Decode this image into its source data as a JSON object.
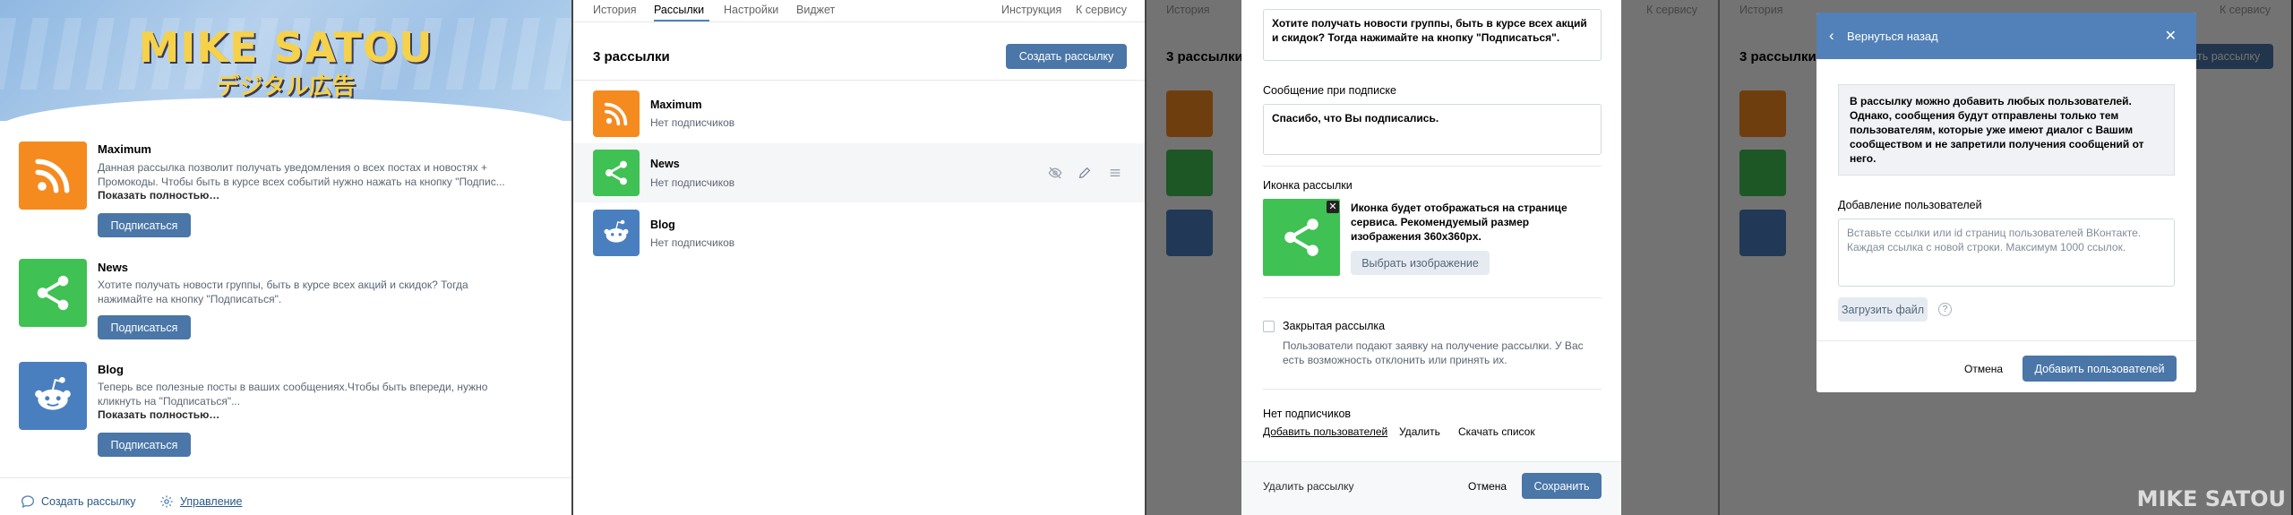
{
  "banner": {
    "title": "MIKE SATOU",
    "subtitle": "デジタル広告"
  },
  "subscribe_label": "Подписаться",
  "show_more": "Показать полностью…",
  "lists": [
    {
      "name": "Maximum",
      "icon": "rss-icon",
      "desc1": "Данная рассылка позволит получать уведомления о всех постах и новостях +",
      "desc2": "Промокоды. Чтобы быть в курсе всех событий нужно нажать на кнопку \"Подпис...",
      "subs": "Нет подписчиков"
    },
    {
      "name": "News",
      "icon": "share-icon",
      "desc1": "Хотите получать новости группы, быть в курсе всех акций и скидок? Тогда",
      "desc2": "нажимайте на кнопку \"Подписаться\".",
      "subs": "Нет подписчиков"
    },
    {
      "name": "Blog",
      "icon": "reddit-icon",
      "desc1": "Теперь все полезные посты в ваших сообщениях.Чтобы быть впереди, нужно",
      "desc2": "кликнуть на \"Подписаться\"...",
      "subs": "Нет подписчиков"
    }
  ],
  "footer": {
    "create": "Создать рассылку",
    "manage": "Управление"
  },
  "admin": {
    "tabs": [
      "История",
      "Рассылки",
      "Настройки",
      "Виджет"
    ],
    "right_links": [
      "Инструкция",
      "К сервису"
    ],
    "count": "3 рассылки",
    "create_button": "Создать рассылку"
  },
  "edit": {
    "desc_value": "Хотите получать новости группы, быть в курсе всех акций и скидок? Тогда нажимайте на кнопку \"Подписаться\".",
    "msg_label": "Сообщение при подписке",
    "msg_value": "Спасибо, что Вы подписались.",
    "icon_label": "Иконка рассылки",
    "icon_hint": "Иконка будет отображаться на странице сервиса. Рекомендуемый размер изображения 360x360px.",
    "choose_image": "Выбрать изображение",
    "closed_label": "Закрытая рассылка",
    "closed_hint": "Пользователи подают заявку на получение рассылки. У Вас есть возможность отклонить или принять их.",
    "no_subs": "Нет подписчиков",
    "add_users": "Добавить пользователей",
    "delete": "Удалить",
    "download": "Скачать список",
    "delete_list": "Удалить рассылку",
    "cancel": "Отмена",
    "save": "Сохранить"
  },
  "addusers": {
    "back": "Вернуться назад",
    "info": "В рассылку можно добавить любых пользователей. Однако, сообщения будут отправлены только тем пользователям, которые уже имеют диалог с Вашим сообществом и не запретили получения сообщений от него.",
    "label": "Добавление пользователей",
    "placeholder": "Вставьте ссылки или id страниц пользователей ВКонтакте. Каждая ссылка с новой строки. Максимум 1000 ссылок.",
    "upload": "Загрузить файл",
    "help": "?",
    "cancel": "Отмена",
    "add": "Добавить пользователей"
  },
  "watermark": "MIKE SATOU",
  "colors": {
    "primary": "#4a76a8",
    "rss": "#f58a1f",
    "share": "#3fc153",
    "reddit": "#4a7fbf",
    "header": "#5181b8"
  }
}
